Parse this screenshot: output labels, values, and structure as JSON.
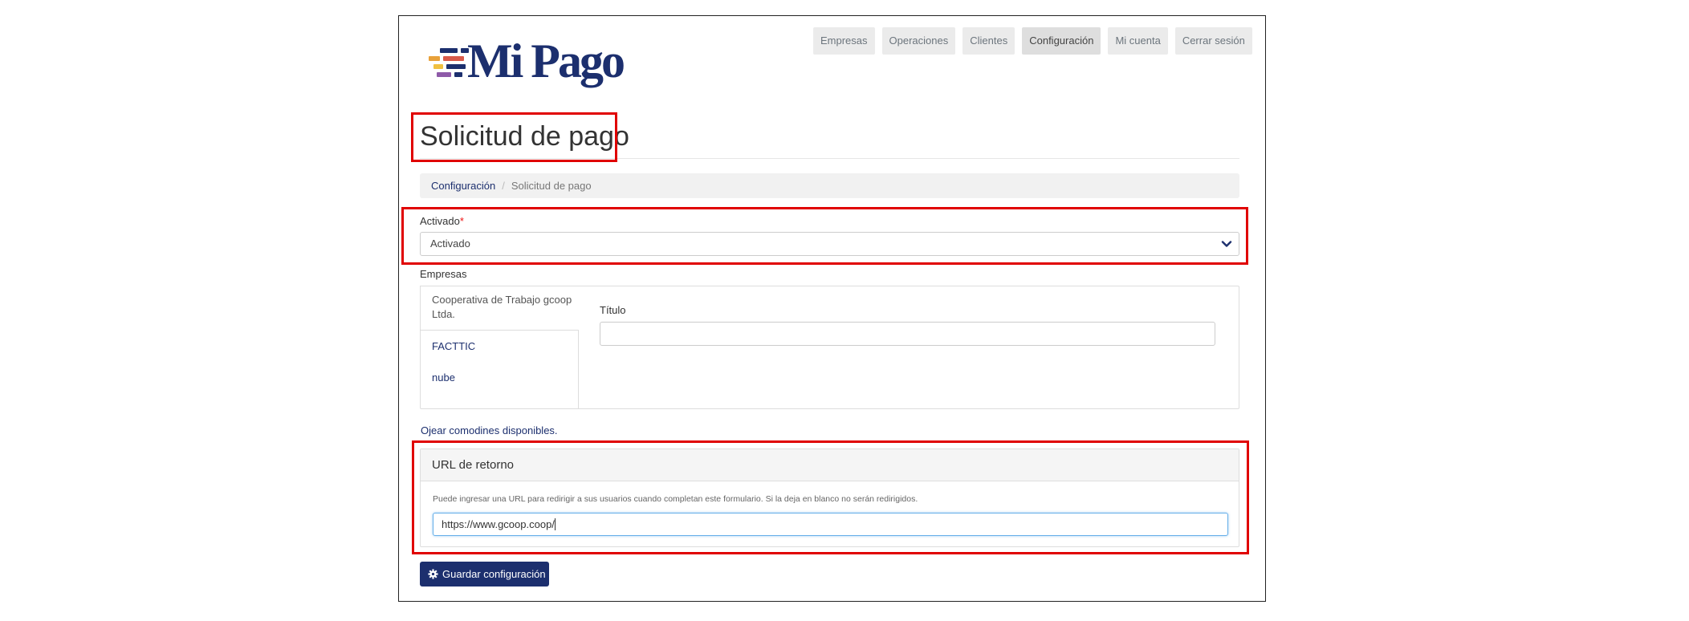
{
  "brand": {
    "logo_text": "Mi Pago",
    "stripe_colors": [
      "#e8a13a",
      "#d95a4a",
      "#1c2f6e",
      "#8e5aa8",
      "#f0c040"
    ]
  },
  "nav": {
    "items": [
      {
        "label": "Empresas"
      },
      {
        "label": "Operaciones"
      },
      {
        "label": "Clientes"
      },
      {
        "label": "Configuración",
        "active": true
      },
      {
        "label": "Mi cuenta"
      },
      {
        "label": "Cerrar sesión"
      }
    ]
  },
  "page": {
    "title": "Solicitud de pago"
  },
  "breadcrumb": {
    "parent": "Configuración",
    "separator": "/",
    "current": "Solicitud de pago"
  },
  "form": {
    "activado": {
      "label": "Activado",
      "required_mark": "*",
      "value": "Activado"
    },
    "empresas": {
      "label": "Empresas",
      "tabs": [
        {
          "line1": "Cooperativa de Trabajo gcoop",
          "line2": "Ltda.",
          "active": true
        },
        {
          "label": "FACTTIC"
        },
        {
          "label": "nube"
        }
      ],
      "titulo_label": "Título",
      "titulo_value": ""
    },
    "wildcards_link": "Ojear comodines disponibles.",
    "return_url": {
      "heading": "URL de retorno",
      "help": "Puede ingresar una URL para redirigir a sus usuarios cuando completan este formulario. Si la deja en blanco no serán redirigidos.",
      "value": "https://www.gcoop.coop/"
    },
    "save_label": "Guardar configuración"
  },
  "colors": {
    "primary": "#1c2f6e",
    "highlight": "#e00000",
    "required": "#e11111"
  },
  "icons": {
    "save": "gear-icon",
    "select": "chevron-down-icon"
  }
}
